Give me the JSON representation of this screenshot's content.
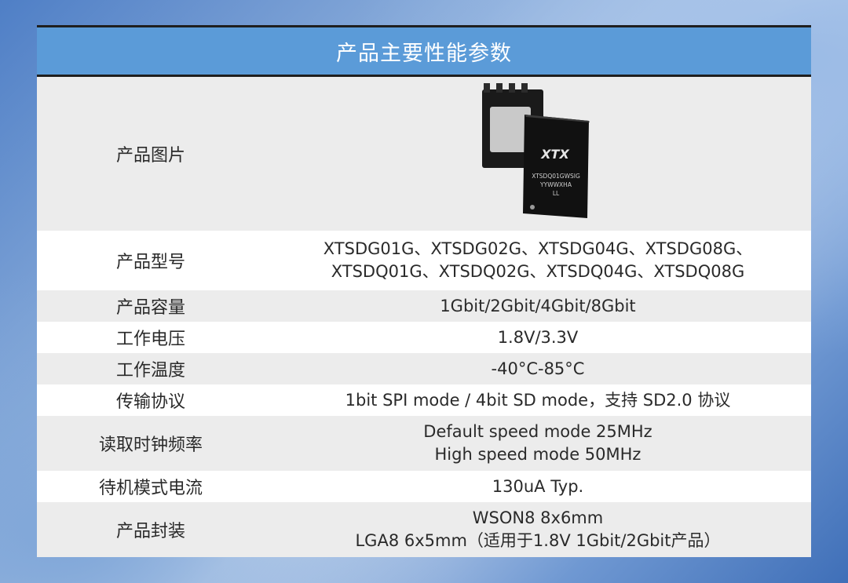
{
  "title": "产品主要性能参数",
  "rows": [
    {
      "label": "产品图片",
      "chip": {
        "brand": "XTX",
        "line1": "XTSDQ01GWSIG",
        "line2": "YYWWXHA",
        "line3": "LL"
      }
    },
    {
      "label": "产品型号",
      "lines": [
        "XTSDG01G、XTSDG02G、XTSDG04G、XTSDG08G、",
        "XTSDQ01G、XTSDQ02G、XTSDQ04G、XTSDQ08G"
      ]
    },
    {
      "label": "产品容量",
      "lines": [
        "1Gbit/2Gbit/4Gbit/8Gbit"
      ]
    },
    {
      "label": "工作电压",
      "lines": [
        "1.8V/3.3V"
      ]
    },
    {
      "label": "工作温度",
      "lines": [
        "-40°C-85°C"
      ]
    },
    {
      "label": "传输协议",
      "lines": [
        "1bit SPI mode / 4bit SD mode，支持 SD2.0 协议"
      ]
    },
    {
      "label": "读取时钟频率",
      "lines": [
        "Default speed mode  25MHz",
        "High speed mode  50MHz"
      ]
    },
    {
      "label": "待机模式电流",
      "lines": [
        "130uA Typ."
      ]
    },
    {
      "label": "产品封装",
      "lines": [
        "WSON8 8x6mm",
        "LGA8 6x5mm（适用于1.8V 1Gbit/2Gbit产品）"
      ]
    }
  ]
}
